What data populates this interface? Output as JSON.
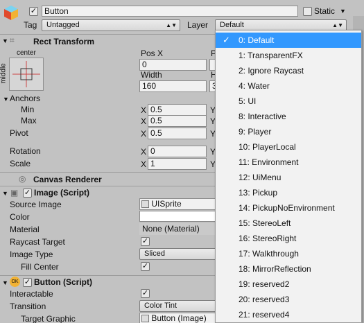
{
  "object": {
    "name": "Button",
    "static_label": "Static",
    "tag_label": "Tag",
    "tag_value": "Untagged",
    "layer_label": "Layer",
    "layer_value": "Default"
  },
  "rect_transform": {
    "title": "Rect Transform",
    "anchor_preset_top": "center",
    "anchor_preset_side": "middle",
    "pos_x_label": "Pos X",
    "pos_x": "0",
    "pos_y_label_partial": "P",
    "width_label": "Width",
    "width": "160",
    "height_label_partial": "H",
    "height_partial": "3",
    "anchors_label": "Anchors",
    "min_label": "Min",
    "max_label": "Max",
    "min_x": "0.5",
    "max_x": "0.5",
    "pivot_label": "Pivot",
    "pivot_x": "0.5",
    "rotation_label": "Rotation",
    "rotation_x": "0",
    "scale_label": "Scale",
    "scale_x": "1",
    "x_axis": "X",
    "y_axis": "Y"
  },
  "canvas_renderer": {
    "title": "Canvas Renderer"
  },
  "image": {
    "title": "Image (Script)",
    "source_image_label": "Source Image",
    "source_image": "UISprite",
    "color_label": "Color",
    "material_label": "Material",
    "material": "None (Material)",
    "raycast_label": "Raycast Target",
    "image_type_label": "Image Type",
    "image_type": "Sliced",
    "fill_center_label": "Fill Center"
  },
  "button": {
    "title": "Button (Script)",
    "interactable_label": "Interactable",
    "transition_label": "Transition",
    "transition": "Color Tint",
    "target_graphic_label": "Target Graphic",
    "target_graphic": "Button (Image)"
  },
  "layer_menu": {
    "items": [
      "0: Default",
      "1: TransparentFX",
      "2: Ignore Raycast",
      "4: Water",
      "5: UI",
      "8: Interactive",
      "9: Player",
      "10: PlayerLocal",
      "11: Environment",
      "12: UiMenu",
      "13: Pickup",
      "14: PickupNoEnvironment",
      "15: StereoLeft",
      "16: StereoRight",
      "17: Walkthrough",
      "18: MirrorReflection",
      "19: reserved2",
      "20: reserved3",
      "21: reserved4"
    ],
    "selected_index": 0
  },
  "colors": {
    "selection": "#3298fe",
    "panel": "#c2c2c2",
    "field": "#f1f1f1"
  }
}
